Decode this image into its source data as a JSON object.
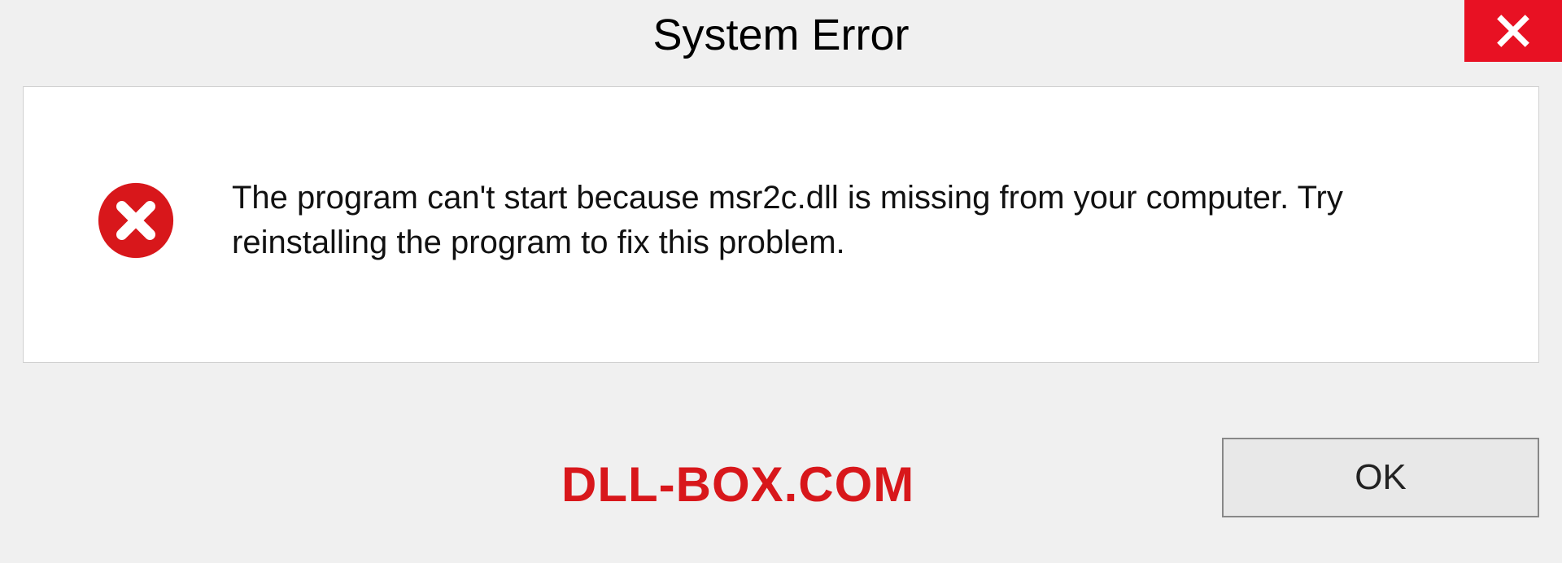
{
  "dialog": {
    "title": "System Error",
    "message": "The program can't start because msr2c.dll is missing from your computer. Try reinstalling the program to fix this problem.",
    "ok_label": "OK"
  },
  "watermark": "DLL-BOX.COM",
  "colors": {
    "close_bg": "#e81123",
    "error_icon": "#d8171b",
    "watermark": "#d8171b"
  }
}
